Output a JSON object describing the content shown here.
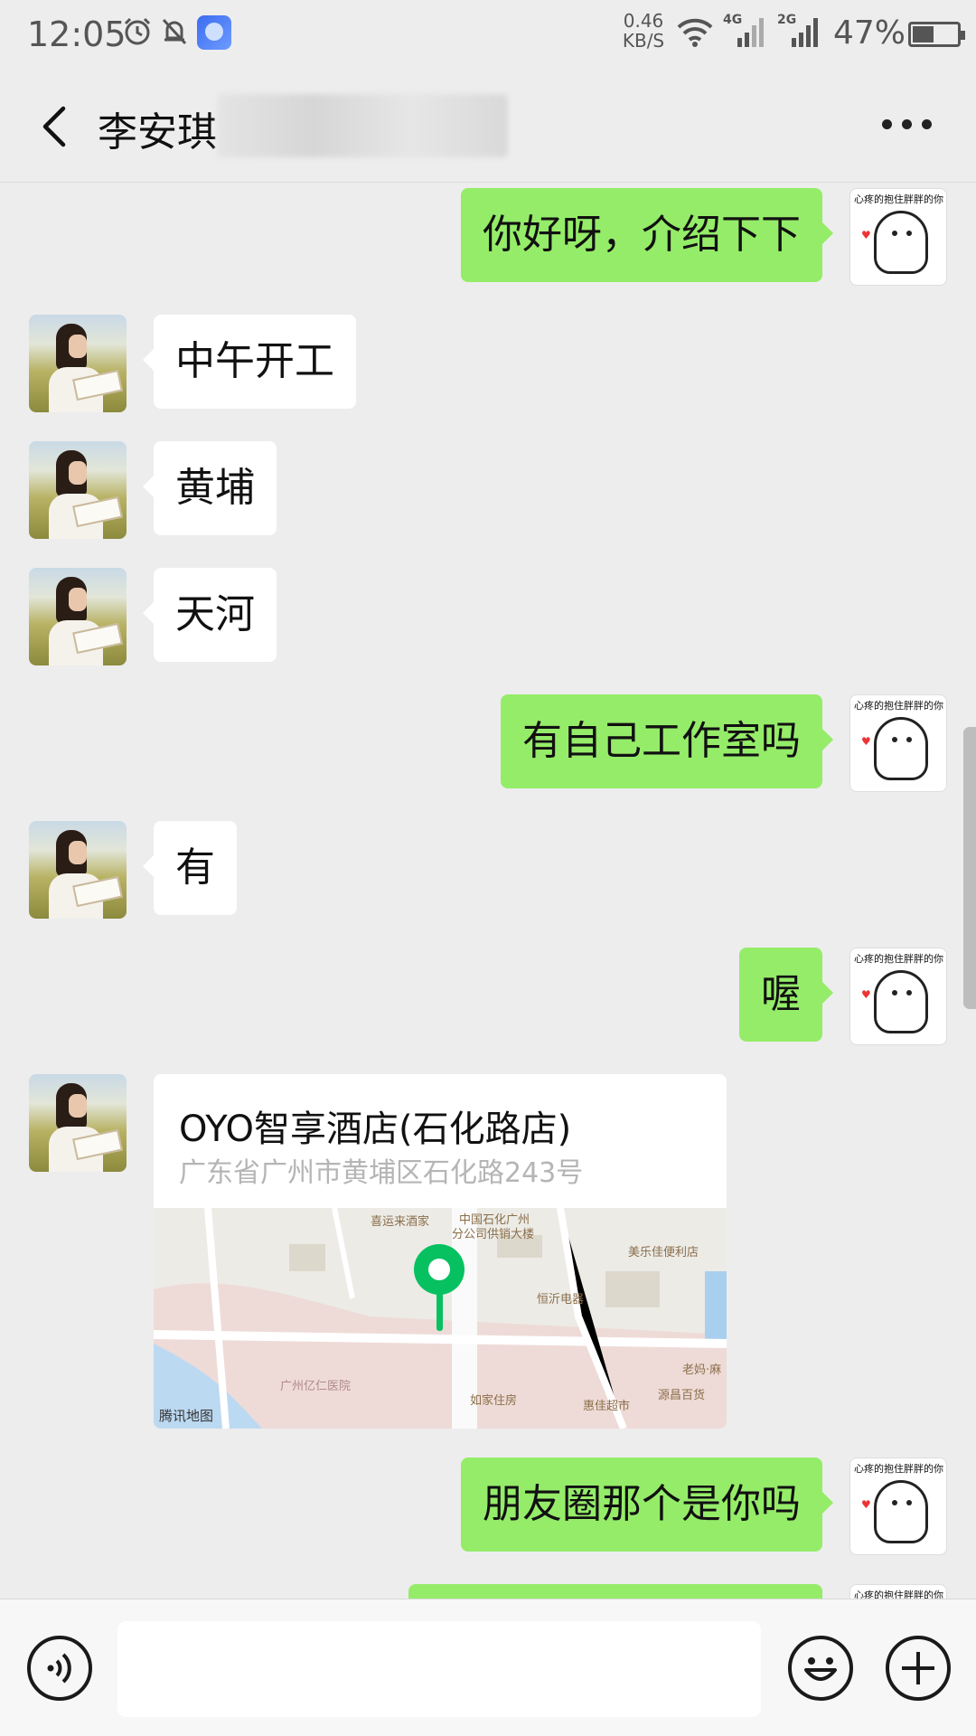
{
  "status_bar": {
    "time": "12:05",
    "net_speed_value": "0.46",
    "net_speed_unit": "KB/S",
    "signal1_label": "4G",
    "signal2_label": "2G",
    "battery_percent": "47%",
    "battery_level": 0.47
  },
  "header": {
    "contact_name": "李安琪",
    "back_icon": "chevron-left-icon",
    "more_icon": "more-dots-icon"
  },
  "messages": [
    {
      "side": "out",
      "text": "你好呀，介绍下下"
    },
    {
      "side": "in",
      "text": "中午开工"
    },
    {
      "side": "in",
      "text": "黄埔"
    },
    {
      "side": "in",
      "text": "天河"
    },
    {
      "side": "out",
      "text": "有自己工作室吗"
    },
    {
      "side": "in",
      "text": "有"
    },
    {
      "side": "out",
      "text": "喔"
    },
    {
      "side": "in",
      "type": "location",
      "name": "OYO智享酒店(石化路店)",
      "address": "广东省广州市黄埔区石化路243号",
      "map_labels": [
        "喜运来酒家",
        "中国石化广州",
        "分公司供销大楼",
        "美乐佳便利店",
        "恒沂电器",
        "广州亿仁医院",
        "如家住房",
        "惠佳超市",
        "源昌百货",
        "老妈·麻"
      ],
      "map_provider": "腾讯地图"
    },
    {
      "side": "out",
      "text": "朋友圈那个是你吗"
    }
  ],
  "my_avatar_caption": "心疼的抱住胖胖的你",
  "input_bar": {
    "voice_icon": "voice-icon",
    "emoji_icon": "emoji-icon",
    "plus_icon": "plus-icon",
    "input_value": ""
  }
}
